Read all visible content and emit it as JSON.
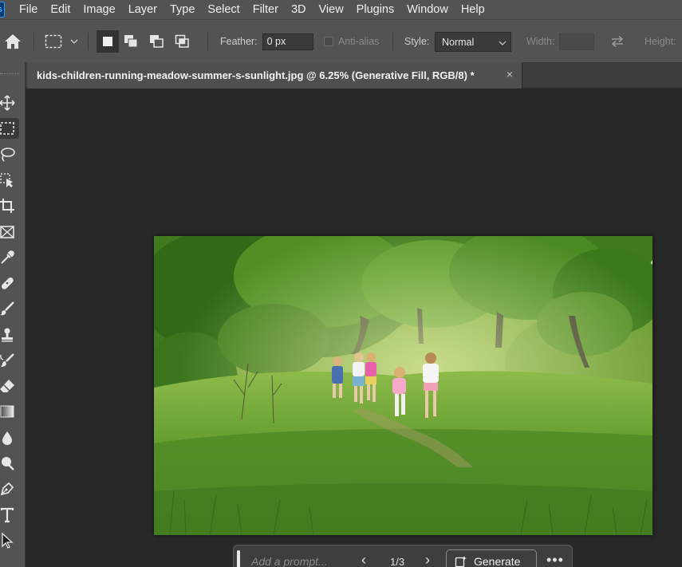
{
  "app": {
    "logo_text": "Ps"
  },
  "menu": [
    "File",
    "Edit",
    "Image",
    "Layer",
    "Type",
    "Select",
    "Filter",
    "3D",
    "View",
    "Plugins",
    "Window",
    "Help"
  ],
  "options": {
    "feather_label": "Feather:",
    "feather_value": "0 px",
    "antialias_label": "Anti-alias",
    "style_label": "Style:",
    "style_value": "Normal",
    "width_label": "Width:",
    "height_label": "Height:"
  },
  "document": {
    "tab_title": "kids-children-running-meadow-summer-s-sunlight.jpg @ 6.25% (Generative Fill, RGB/8) *"
  },
  "taskbar": {
    "prompt_placeholder": "Add a prompt...",
    "page_count": "1/3",
    "generate_label": "Generate"
  },
  "tools": [
    "move-tool",
    "marquee-tool",
    "lasso-tool",
    "object-selection-tool",
    "crop-tool",
    "frame-tool",
    "eyedropper-tool",
    "healing-brush-tool",
    "brush-tool",
    "clone-stamp-tool",
    "history-brush-tool",
    "eraser-tool",
    "gradient-tool",
    "blur-tool",
    "dodge-tool",
    "pen-tool",
    "type-tool",
    "path-selection-tool"
  ],
  "colors": {
    "menubar": "#535353",
    "canvas": "#282828",
    "accent": "#31a8ff"
  }
}
